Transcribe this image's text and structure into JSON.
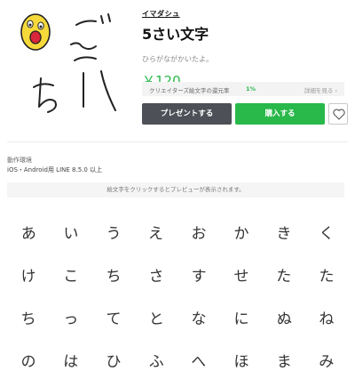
{
  "product": {
    "author": "イマダシュ",
    "title": "5さい文字",
    "description": "ひらがながかいたよ。",
    "price": "￥120",
    "thumbnail_icon": "sticker-face-gochi-icon",
    "thumbnail_letters": [
      "ご",
      "ち"
    ]
  },
  "return_rate": {
    "label": "クリエイターズ絵文字の還元率",
    "value": "1%",
    "more": "詳細を見る ›"
  },
  "buttons": {
    "gift": "プレゼントする",
    "buy": "購入する",
    "like_icon": "heart-outline-icon"
  },
  "environment": {
    "title": "動作環境",
    "value": "iOS・Android用 LINE 8.5.0 以上"
  },
  "preview_hint": "絵文字をクリックするとプレビューが表示されます。",
  "emoji_grid": [
    "あ",
    "い",
    "う",
    "え",
    "お",
    "か",
    "き",
    "く",
    "け",
    "こ",
    "ち",
    "さ",
    "す",
    "せ",
    "た",
    "た",
    "ち",
    "っ",
    "て",
    "と",
    "な",
    "に",
    "ぬ",
    "ね",
    "の",
    "は",
    "ひ",
    "ふ",
    "へ",
    "ほ",
    "ま",
    "み"
  ],
  "colors": {
    "accent": "#29b84a",
    "gift_button": "#4d5157",
    "face": "#f5d93a"
  }
}
